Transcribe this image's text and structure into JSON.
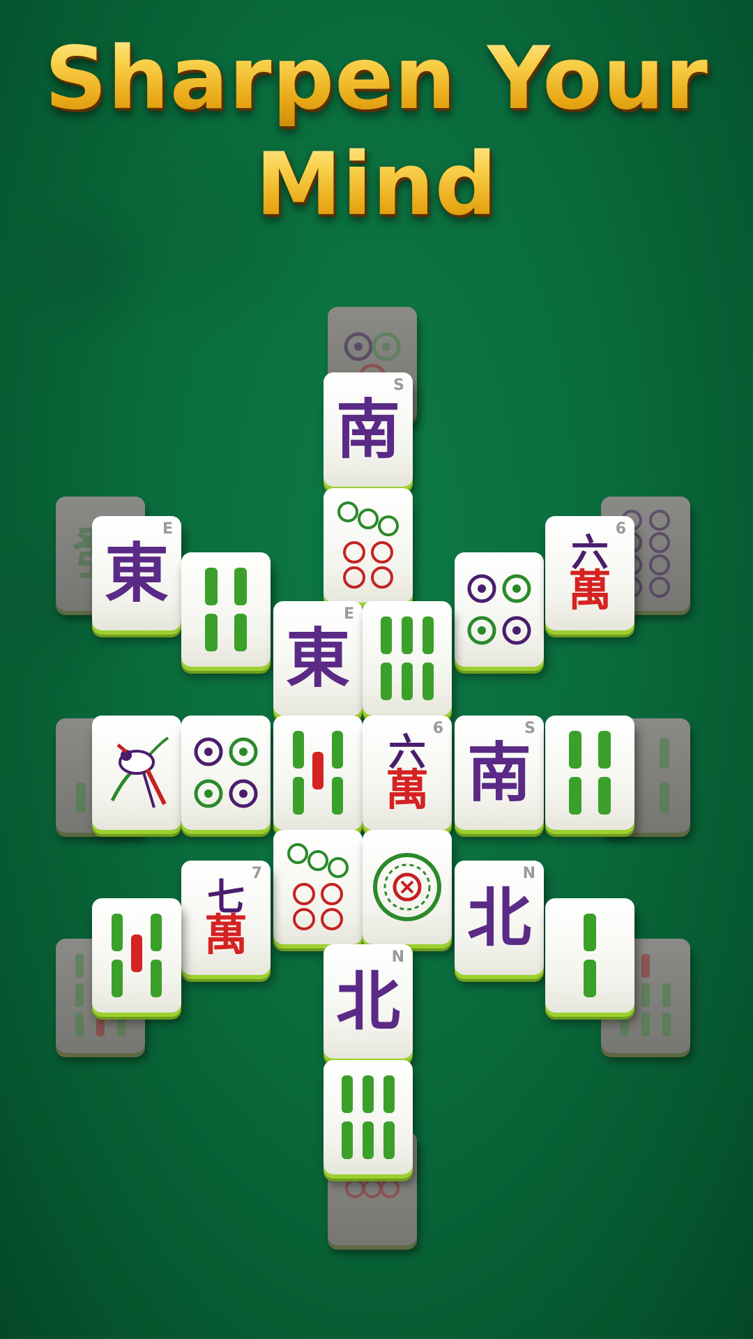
{
  "headline": {
    "line1": "Sharpen Your",
    "line2": "Mind"
  },
  "colors": {
    "felt": "#0a6b3c",
    "title_gold": "#f7c531",
    "tile_face": "#f4f4ee",
    "tile_edge": "#9bd02e",
    "bamboo_green": "#3aa02a",
    "dot_purple": "#5a2a86",
    "char_red": "#d52222"
  },
  "tiles": {
    "top_dots_under": {
      "kind": "dots",
      "count": 3
    },
    "south_top": {
      "kind": "wind",
      "glyph": "南",
      "corner": "S"
    },
    "dots_seven_top": {
      "kind": "dots",
      "count": 7
    },
    "east_left": {
      "kind": "wind",
      "glyph": "東",
      "corner": "E"
    },
    "green_dragon_under": {
      "kind": "dragon",
      "glyph": "發"
    },
    "bamboo_four_left": {
      "kind": "bamboo",
      "count": 4
    },
    "east_center": {
      "kind": "wind",
      "glyph": "東",
      "corner": "E"
    },
    "bamboo_six_center": {
      "kind": "bamboo",
      "count": 6
    },
    "dots_four_right": {
      "kind": "dots",
      "count": 4
    },
    "six_char_right": {
      "kind": "char",
      "num": "六",
      "wan": "萬",
      "corner": "6"
    },
    "dots_eight_under": {
      "kind": "dots",
      "count": 8
    },
    "bird_left": {
      "kind": "bamboo",
      "count": 1
    },
    "dots_four_mid": {
      "kind": "dots",
      "count": 4
    },
    "bamboo_five_mid": {
      "kind": "bamboo",
      "count": 5
    },
    "six_char_mid": {
      "kind": "char",
      "num": "六",
      "wan": "萬",
      "corner": "6"
    },
    "south_mid": {
      "kind": "wind",
      "glyph": "南",
      "corner": "S"
    },
    "bamboo_four_mid": {
      "kind": "bamboo",
      "count": 4
    },
    "dots_seven_low": {
      "kind": "dots",
      "count": 7
    },
    "dots_one_low": {
      "kind": "dots",
      "count": 1
    },
    "seven_char_low": {
      "kind": "char",
      "num": "七",
      "wan": "萬",
      "corner": "7"
    },
    "north_low": {
      "kind": "wind",
      "glyph": "北",
      "corner": "N"
    },
    "bamboo_five_low": {
      "kind": "bamboo",
      "count": 5
    },
    "bamboo_two_low": {
      "kind": "bamboo",
      "count": 2
    },
    "bamboo_seven_under": {
      "kind": "bamboo",
      "count": 7
    },
    "bamboo_nine_under": {
      "kind": "bamboo",
      "count": 9
    },
    "north_bottom": {
      "kind": "wind",
      "glyph": "北",
      "corner": "N"
    },
    "bamboo_six_bottom": {
      "kind": "bamboo",
      "count": 6
    },
    "dots_bottom_under": {
      "kind": "dots",
      "count": 6
    }
  }
}
